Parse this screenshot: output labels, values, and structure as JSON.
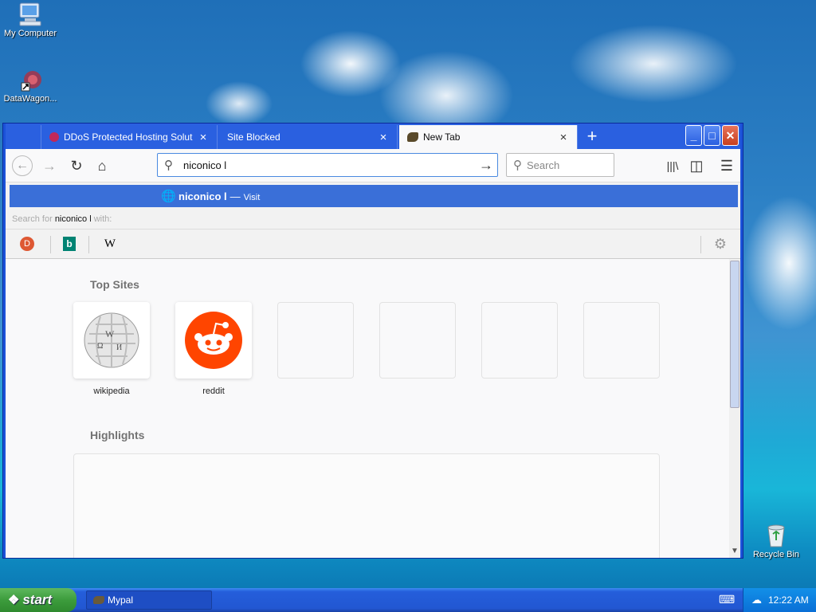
{
  "desktop": {
    "icons": [
      {
        "label": "My Computer"
      },
      {
        "label": "DataWagon..."
      },
      {
        "label": "Recycle Bin"
      }
    ]
  },
  "browser": {
    "tabs": [
      {
        "title": "DDoS Protected Hosting Solutions",
        "close": "×"
      },
      {
        "title": "Site Blocked",
        "close": "×"
      },
      {
        "title": "New Tab",
        "close": "×"
      }
    ],
    "new_tab": "+",
    "window_buttons": {
      "minimize": "_",
      "maximize": "□",
      "close": "✕"
    },
    "toolbar": {
      "back": "←",
      "forward": "→",
      "reload": "↻",
      "home": "⌂",
      "url_value": "niconico l",
      "go": "→",
      "search_placeholder": "Search",
      "library": "|||\\",
      "sidebar": "◫",
      "menu": "☰"
    },
    "dropdown": {
      "suggestion": "niconico l",
      "dash": "—",
      "action": "Visit",
      "search_for_prefix": "Search for ",
      "search_for_query": "niconico l",
      "search_for_suffix": " with:",
      "engines": [
        "DuckDuckGo",
        "Bing",
        "Wikipedia"
      ],
      "engine_glyphs": {
        "ddg": "D",
        "bing": "b",
        "wiki": "W"
      },
      "settings": "⚙"
    },
    "newtab": {
      "top_sites_title": "Top Sites",
      "top_sites": [
        {
          "label": "wikipedia"
        },
        {
          "label": "reddit"
        },
        {
          "label": ""
        },
        {
          "label": ""
        },
        {
          "label": ""
        },
        {
          "label": ""
        }
      ],
      "highlights_title": "Highlights"
    }
  },
  "taskbar": {
    "start_label": "start",
    "tasks": [
      {
        "label": "Mypal"
      }
    ],
    "clock": "12:22 AM"
  },
  "colors": {
    "tab_active_bg": "#f9f9fa",
    "titlebar": "#2a60e0",
    "suggest_highlight": "#3a6fd8",
    "reddit": "#ff4500"
  }
}
